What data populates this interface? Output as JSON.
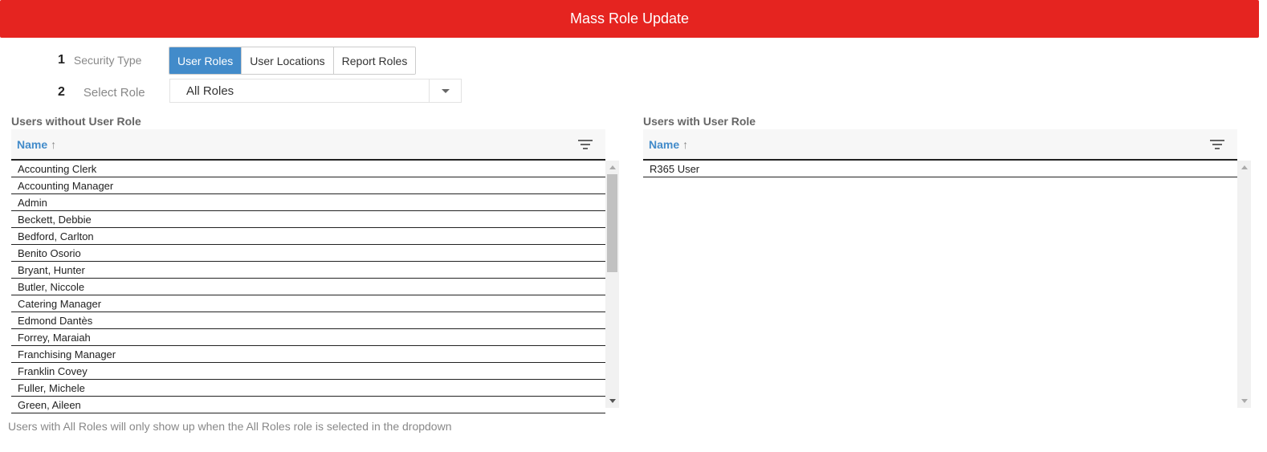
{
  "header": {
    "title": "Mass Role Update"
  },
  "steps": [
    {
      "number": "1",
      "label": "Security Type"
    },
    {
      "number": "2",
      "label": "Select Role"
    }
  ],
  "security_type": {
    "options": [
      "User Roles",
      "User Locations",
      "Report Roles"
    ],
    "selected": "User Roles"
  },
  "role_select": {
    "value": "All Roles"
  },
  "left_panel": {
    "title": "Users without User Role",
    "column": "Name",
    "rows": [
      "Accounting Clerk",
      "Accounting Manager",
      "Admin",
      "Beckett, Debbie",
      "Bedford, Carlton",
      "Benito Osorio",
      "Bryant, Hunter",
      "Butler, Niccole",
      "Catering Manager",
      "Edmond Dantès",
      "Forrey, Maraiah",
      "Franchising Manager",
      "Franklin Covey",
      "Fuller, Michele",
      "Green, Aileen"
    ]
  },
  "right_panel": {
    "title": "Users with User Role",
    "column": "Name",
    "rows": [
      "R365 User"
    ]
  },
  "footnote": "Users with All Roles will only show up when the All Roles role is selected in the dropdown",
  "colors": {
    "header": "#e52420",
    "accent": "#428bca"
  },
  "icons": {
    "sort": "arrow-up-icon",
    "filter": "filter-icon",
    "dropdown": "caret-down-icon"
  }
}
